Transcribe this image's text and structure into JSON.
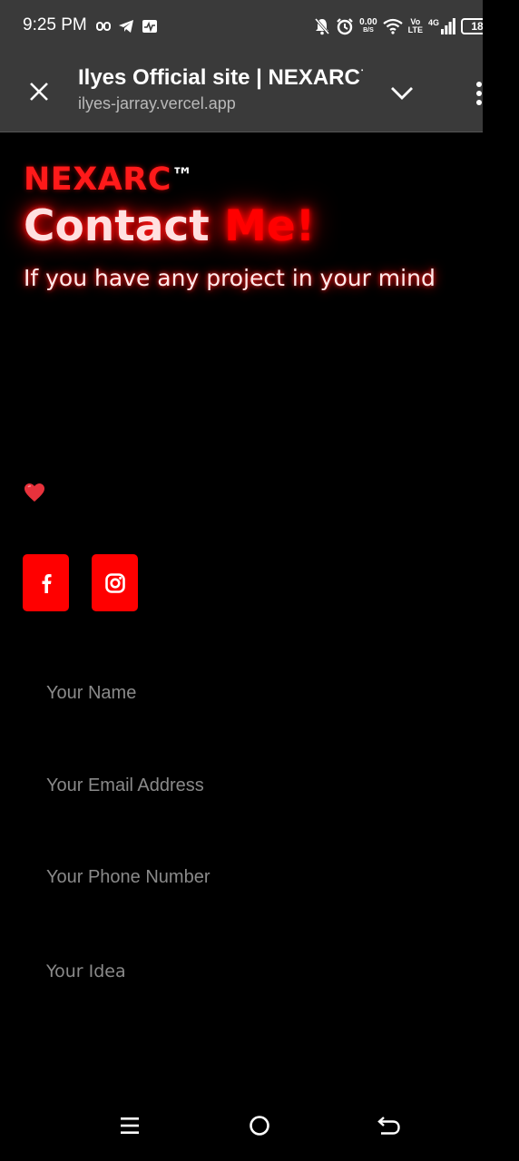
{
  "status_bar": {
    "time": "9:25 PM",
    "net_speed_value": "0.00",
    "net_speed_unit": "B/S",
    "volte_top": "Vo",
    "volte_bottom": "LTE",
    "network_type": "4G",
    "battery_level": "18",
    "icons_left": [
      "link-icon",
      "telegram-icon",
      "activity-icon"
    ],
    "icons_right": [
      "bell-off-icon",
      "alarm-icon",
      "wifi-icon",
      "signal-icon",
      "battery-icon",
      "charging-icon"
    ]
  },
  "browser": {
    "title": "Ilyes Official site | NEXARC™",
    "url": "ilyes-jarray.vercel.app"
  },
  "page": {
    "brand_name": "NEXARC",
    "brand_tm": "™",
    "heading_part1": "Contact ",
    "heading_part2": "Me!",
    "subheading": "If you have any project in your mind",
    "accent_color": "#ff0000",
    "social": [
      "facebook-icon",
      "instagram-icon"
    ],
    "form": {
      "name_placeholder": "Your Name",
      "email_placeholder": "Your Email Address",
      "phone_placeholder": "Your Phone Number",
      "idea_placeholder": "Your Idea"
    }
  },
  "nav_bar": {
    "buttons": [
      "menu-icon",
      "home-icon",
      "back-icon"
    ]
  }
}
